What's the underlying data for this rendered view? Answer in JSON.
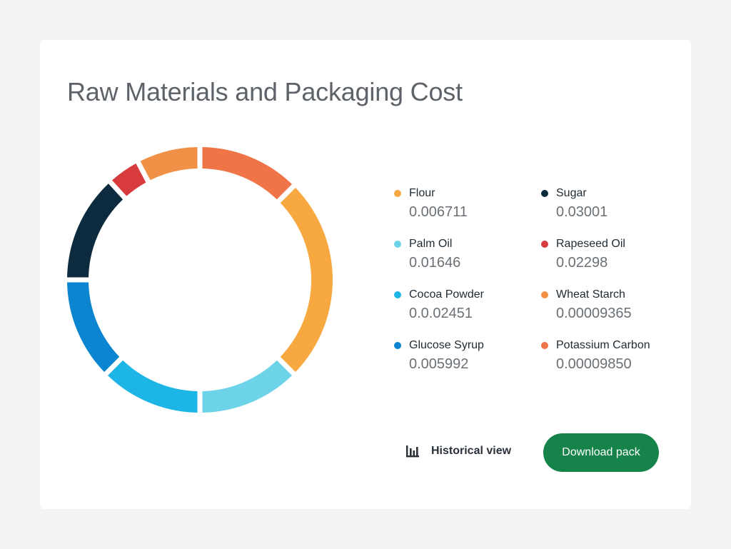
{
  "card": {
    "title": "Raw Materials and Packaging Cost"
  },
  "actions": {
    "historical_label": "Historical view",
    "historical_icon": "bar-chart-icon",
    "download_label": "Download pack",
    "download_color": "#16834a"
  },
  "chart_data": {
    "type": "pie",
    "variant": "donut",
    "title": "Raw Materials and Packaging Cost",
    "legend_position": "right",
    "legend": [
      {
        "name": "Flour",
        "value": "0.006711",
        "color": "#f8a840"
      },
      {
        "name": "Sugar",
        "value": "0.03001",
        "color": "#0d2b3e"
      },
      {
        "name": "Palm Oil",
        "value": "0.01646",
        "color": "#6dd3e8"
      },
      {
        "name": "Rapeseed Oil",
        "value": "0.02298",
        "color": "#d73b3e"
      },
      {
        "name": "Cocoa Powder",
        "value": "0.0.02451",
        "color": "#1cb5e6"
      },
      {
        "name": "Wheat Starch",
        "value": "0.00009365",
        "color": "#f19148"
      },
      {
        "name": "Glucose Syrup",
        "value": "0.005992",
        "color": "#0b85cf"
      },
      {
        "name": "Potassium Carbon",
        "value": "0.00009850",
        "color": "#ef7448"
      }
    ],
    "slices": [
      {
        "name": "Potassium Carbon",
        "share": 12.5
      },
      {
        "name": "Flour",
        "share": 25
      },
      {
        "name": "Palm Oil",
        "share": 12.5
      },
      {
        "name": "Cocoa Powder",
        "share": 12.5
      },
      {
        "name": "Glucose Syrup",
        "share": 12.5
      },
      {
        "name": "Sugar",
        "share": 13.2
      },
      {
        "name": "Rapeseed Oil",
        "share": 4.1
      },
      {
        "name": "Wheat Starch",
        "share": 7.7
      }
    ]
  }
}
